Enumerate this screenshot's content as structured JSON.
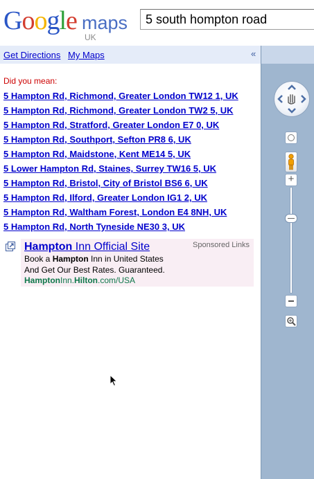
{
  "header": {
    "logo_letters": [
      "G",
      "o",
      "o",
      "g",
      "l",
      "e"
    ],
    "logo_maps": "maps",
    "logo_region": "UK",
    "search_value": "5 south hompton road"
  },
  "linkbar": {
    "get_directions": "Get Directions",
    "my_maps": "My Maps",
    "collapse_symbol": "«"
  },
  "results": {
    "did_you_mean": "Did you mean:",
    "suggestions": [
      "5 Hampton Rd, Richmond, Greater London TW12 1, UK",
      "5 Hampton Rd, Richmond, Greater London TW2 5, UK",
      "5 Hampton Rd, Stratford, Greater London E7 0, UK",
      "5 Hampton Rd, Southport, Sefton PR8 6, UK",
      "5 Hampton Rd, Maidstone, Kent ME14 5, UK",
      "5 Lower Hampton Rd, Staines, Surrey TW16 5, UK",
      "5 Hampton Rd, Bristol, City of Bristol BS6 6, UK",
      "5 Hampton Rd, Ilford, Greater London IG1 2, UK",
      "5 Hampton Rd, Waltham Forest, London E4 8NH, UK",
      "5 Hampton Rd, North Tyneside NE30 3, UK"
    ]
  },
  "ad": {
    "title_bold": "Hampton",
    "title_rest": " Inn Official Site",
    "sponsored": "Sponsored Links",
    "line1_pre": "Book a ",
    "line1_bold": "Hampton",
    "line1_post": " Inn in United States",
    "line2": "And Get Our Best Rates. Guaranteed.",
    "url_pre": "",
    "url_bold1": "Hampton",
    "url_mid": "Inn.",
    "url_bold2": "Hilton",
    "url_post": ".com/USA"
  },
  "map_controls": {
    "zoom_in_symbol": "+",
    "zoom_level": 0.72
  },
  "icons": {
    "ad": "external-ad-icon",
    "pan": "pan-control-icon",
    "pegman": "pegman-icon",
    "zoom_box": "magnifier-icon",
    "cursor": "mouse-pointer-icon"
  },
  "colors": {
    "link": "#0000cc",
    "did_you_mean": "#cc0000",
    "linkbar_bg": "#e5ecf9",
    "ad_bg": "#f9eef4",
    "ad_url": "#0e774a",
    "map_bg": "#9fb6cf"
  }
}
